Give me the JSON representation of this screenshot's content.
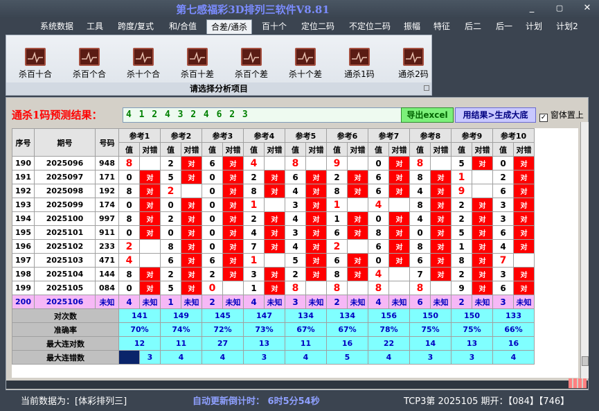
{
  "window": {
    "title": "第七感福彩3D排列三软件V8.81",
    "min": "_",
    "max": "▢",
    "close": "✕"
  },
  "menu": [
    "系统数据",
    "工具",
    "跨度/复式",
    "和/合值",
    "合差/通杀",
    "百十个",
    "定位二码",
    "不定位二码",
    "振幅",
    "特征",
    "后二",
    "后一",
    "计划",
    "计划2"
  ],
  "ribbon": {
    "buttons": [
      "杀百十合",
      "杀百个合",
      "杀十个合",
      "杀百十差",
      "杀百个差",
      "杀十个差",
      "通杀1码",
      "通杀2码"
    ],
    "caption": "请选择分析项目"
  },
  "predict": {
    "label": "通杀1码预测结果：",
    "value": "4 1 2 4 3 2 4 6 2 3",
    "excel": "导出excel",
    "big": "用结果>生成大底",
    "on_top": "窗体置上"
  },
  "table": {
    "headers": {
      "seq": "序号",
      "period": "期号",
      "num": "号码",
      "ref": [
        "参考1",
        "参考2",
        "参考3",
        "参考4",
        "参考5",
        "参考6",
        "参考7",
        "参考8",
        "参考9",
        "参考10"
      ],
      "val": "值",
      "mark": "对错"
    },
    "hit_text": "对",
    "rows": [
      {
        "seq": "190",
        "period": "2025096",
        "num": "948",
        "vals": [
          "8",
          "2",
          "6",
          "4",
          "8",
          "9",
          "0",
          "8",
          "5",
          "0"
        ],
        "hits": [
          0,
          1,
          1,
          0,
          0,
          0,
          1,
          0,
          1,
          1
        ]
      },
      {
        "seq": "191",
        "period": "2025097",
        "num": "171",
        "vals": [
          "0",
          "5",
          "0",
          "2",
          "6",
          "2",
          "6",
          "8",
          "1",
          "2"
        ],
        "hits": [
          1,
          1,
          1,
          1,
          1,
          1,
          1,
          1,
          0,
          1
        ]
      },
      {
        "seq": "192",
        "period": "2025098",
        "num": "192",
        "vals": [
          "8",
          "2",
          "0",
          "8",
          "4",
          "8",
          "6",
          "4",
          "9",
          "6"
        ],
        "hits": [
          1,
          0,
          1,
          1,
          1,
          1,
          1,
          1,
          0,
          1
        ]
      },
      {
        "seq": "193",
        "period": "2025099",
        "num": "174",
        "vals": [
          "0",
          "0",
          "0",
          "1",
          "3",
          "1",
          "4",
          "8",
          "2",
          "3"
        ],
        "hits": [
          1,
          1,
          1,
          0,
          1,
          0,
          0,
          1,
          1,
          1
        ]
      },
      {
        "seq": "194",
        "period": "2025100",
        "num": "997",
        "vals": [
          "8",
          "2",
          "0",
          "2",
          "4",
          "1",
          "0",
          "4",
          "2",
          "3"
        ],
        "hits": [
          1,
          1,
          1,
          1,
          1,
          1,
          1,
          1,
          1,
          1
        ]
      },
      {
        "seq": "195",
        "period": "2025101",
        "num": "911",
        "vals": [
          "0",
          "0",
          "0",
          "4",
          "3",
          "6",
          "8",
          "0",
          "5",
          "6"
        ],
        "hits": [
          1,
          1,
          1,
          1,
          1,
          1,
          1,
          1,
          1,
          1
        ]
      },
      {
        "seq": "196",
        "period": "2025102",
        "num": "233",
        "vals": [
          "2",
          "8",
          "0",
          "7",
          "4",
          "2",
          "6",
          "8",
          "1",
          "4"
        ],
        "hits": [
          0,
          1,
          1,
          1,
          1,
          0,
          1,
          1,
          1,
          1
        ]
      },
      {
        "seq": "197",
        "period": "2025103",
        "num": "471",
        "vals": [
          "4",
          "6",
          "6",
          "1",
          "5",
          "6",
          "0",
          "6",
          "8",
          "7"
        ],
        "hits": [
          0,
          1,
          1,
          0,
          1,
          1,
          1,
          1,
          1,
          0
        ]
      },
      {
        "seq": "198",
        "period": "2025104",
        "num": "144",
        "vals": [
          "8",
          "2",
          "2",
          "3",
          "2",
          "8",
          "4",
          "7",
          "2",
          "3"
        ],
        "hits": [
          1,
          1,
          1,
          1,
          1,
          1,
          0,
          1,
          1,
          1
        ]
      },
      {
        "seq": "199",
        "period": "2025105",
        "num": "084",
        "vals": [
          "0",
          "5",
          "0",
          "1",
          "8",
          "8",
          "8",
          "8",
          "9",
          "6"
        ],
        "hits": [
          1,
          1,
          0,
          1,
          0,
          0,
          0,
          0,
          1,
          1
        ]
      },
      {
        "seq": "200",
        "period": "2025106",
        "num": "未知",
        "vals": [
          "4",
          "1",
          "2",
          "4",
          "3",
          "2",
          "4",
          "6",
          "2",
          "3"
        ],
        "unknown": "未知"
      }
    ],
    "stats": [
      {
        "label": "对次数",
        "values": [
          "141",
          "149",
          "145",
          "147",
          "134",
          "134",
          "156",
          "150",
          "150",
          "133"
        ]
      },
      {
        "label": "准确率",
        "values": [
          "70%",
          "74%",
          "72%",
          "73%",
          "67%",
          "67%",
          "78%",
          "75%",
          "75%",
          "66%"
        ]
      },
      {
        "label": "最大连对数",
        "values": [
          "12",
          "11",
          "27",
          "13",
          "11",
          "16",
          "22",
          "14",
          "13",
          "16"
        ]
      },
      {
        "label": "最大连错数",
        "values": [
          "3",
          "4",
          "4",
          "3",
          "4",
          "5",
          "4",
          "3",
          "3",
          "4"
        ]
      }
    ]
  },
  "status": {
    "left": "当前数据为：[体彩排列三]",
    "mid": "自动更新倒计时：  6时5分54秒",
    "right": "TCP3第 2025105 期开：【084】【746】"
  }
}
